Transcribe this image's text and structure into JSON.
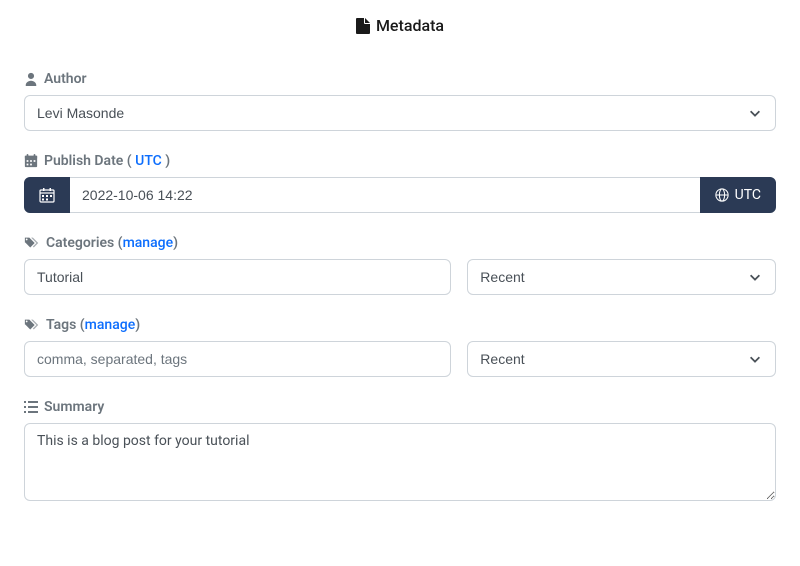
{
  "header": {
    "title": "Metadata"
  },
  "author": {
    "label": "Author",
    "value": "Levi Masonde"
  },
  "publish_date": {
    "label_prefix": "Publish Date (",
    "label_utc": "UTC",
    "label_suffix": " )",
    "value": "2022-10-06 14:22",
    "tz_badge": "UTC"
  },
  "categories": {
    "label": "Categories (",
    "manage": "manage",
    "label_suffix": ")",
    "value": "Tutorial",
    "recent_selected": "Recent"
  },
  "tags": {
    "label": "Tags (",
    "manage": "manage",
    "label_suffix": ")",
    "value": "",
    "placeholder": "comma, separated, tags",
    "recent_selected": "Recent"
  },
  "summary": {
    "label": "Summary",
    "value": "This is a blog post for your tutorial"
  }
}
